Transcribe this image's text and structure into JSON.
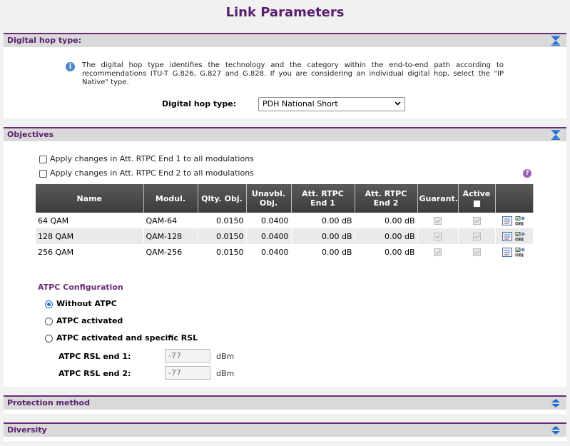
{
  "page": {
    "title": "Link Parameters"
  },
  "sections": {
    "digital_hop": {
      "label": "Digital hop type:"
    },
    "objectives": {
      "label": "Objectives"
    },
    "protection": {
      "label": "Protection method"
    },
    "diversity": {
      "label": "Diversity"
    }
  },
  "digital_hop": {
    "info": "The digital hop type identifies the technology and the category within the end-to-end path according to recommendations ITU-T G.826, G.827 and G.828. If you are considering an individual digital hop, select the \"IP Native\" type.",
    "field_label": "Digital hop type:",
    "selected": "PDH National Short"
  },
  "objectives": {
    "apply_end1": "Apply changes in Att. RTPC End 1 to all modulations",
    "apply_end2": "Apply changes in Att. RTPC End 2 to all modulations",
    "columns": {
      "name": "Name",
      "modul": "Modul.",
      "qlty": "Qlty. Obj.",
      "unavbl_1": "Unavbl.",
      "unavbl_2": "Obj.",
      "att1_1": "Att. RTPC",
      "att1_2": "End 1",
      "att2_1": "Att. RTPC",
      "att2_2": "End 2",
      "guarant": "Guarant.",
      "active": "Active"
    },
    "rows": [
      {
        "name": "64 QAM",
        "modul": "QAM-64",
        "qlty": "0.0150",
        "unavbl": "0.0400",
        "att1": "0.00 dB",
        "att2": "0.00 dB"
      },
      {
        "name": "128 QAM",
        "modul": "QAM-128",
        "qlty": "0.0150",
        "unavbl": "0.0400",
        "att1": "0.00 dB",
        "att2": "0.00 dB"
      },
      {
        "name": "256 QAM",
        "modul": "QAM-256",
        "qlty": "0.0150",
        "unavbl": "0.0400",
        "att1": "0.00 dB",
        "att2": "0.00 dB"
      }
    ],
    "icons": {
      "edit": "list-edit-icon",
      "obj": "obj-settings-icon"
    }
  },
  "atpc": {
    "title": "ATPC Configuration",
    "options": [
      "Without ATPC",
      "ATPC activated",
      "ATPC activated and specific RSL"
    ],
    "selected_index": 0,
    "rsl1_label": "ATPC RSL end 1:",
    "rsl1_value": "-77",
    "rsl2_label": "ATPC RSL end 2:",
    "rsl2_value": "-77",
    "unit": "dBm"
  },
  "colors": {
    "accent": "#5a1f6e",
    "header_bg": "#d9d9d9",
    "toggle": "#1a6fd0"
  }
}
